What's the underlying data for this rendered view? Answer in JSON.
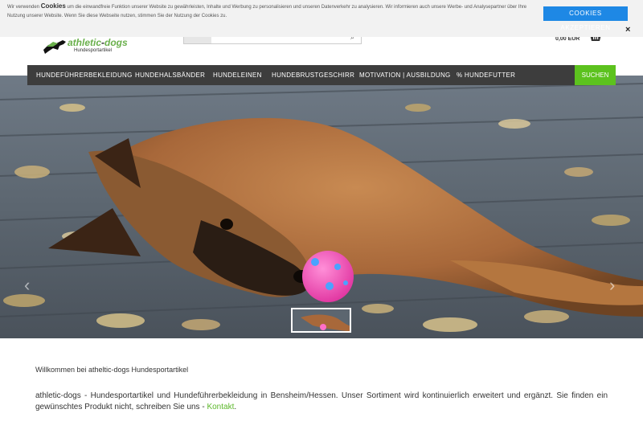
{
  "cookie": {
    "text_before": "Wir verwenden ",
    "highlight": "Cookies",
    "text_after": " um die einwandfreie Funktion unserer Website zu gewährleisten, Inhalte und Werbung zu personalisieren und unseren Datenverkehr zu analysieren. Wir informieren auch unsere Werbe- und Analysepartner über Ihre Nutzung unserer Website. Wenn Sie diese Webseite nutzen, stimmen Sie der Nutzung der Cookies zu.",
    "accept_label": "COOKIES AKZEPTIEREN",
    "close_label": "×"
  },
  "header": {
    "logo_name_colored": "athletic",
    "logo_name_dash": "-",
    "logo_name_rest": "dogs",
    "logo_sub": "Hundesportartikel",
    "cart_amount": "0,00 EUR",
    "search_icon_glyph": "⌕"
  },
  "nav": {
    "items": [
      "HUNDEFÜHRERBEKLEIDUNG",
      "HUNDEHALSBÄNDER",
      "HUNDELEINEN",
      "HUNDEBRUSTGESCHIRR",
      "MOTIVATION | AUSBILDUNG",
      "% HUNDEFUTTER"
    ],
    "search_label": "SUCHEN"
  },
  "hero": {
    "prev_glyph": "‹",
    "next_glyph": "›"
  },
  "content": {
    "welcome": "Willkommen bei atheltic-dogs Hundesportartikel",
    "intro_text": "athletic-dogs - Hundesportartikel und Hundeführerbekleidung in Bensheim/Hessen. Unser Sortiment wird kontinuierlich erweitert und ergänzt. Sie finden ein gewünschtes Produkt nicht, schreiben Sie uns - ",
    "intro_link": "Kontakt",
    "intro_end": "."
  },
  "colors": {
    "accent_green": "#5cc21e",
    "nav_bg": "#3d3d3d",
    "cookie_button": "#1e88e5",
    "link_green": "#5cb82a"
  }
}
